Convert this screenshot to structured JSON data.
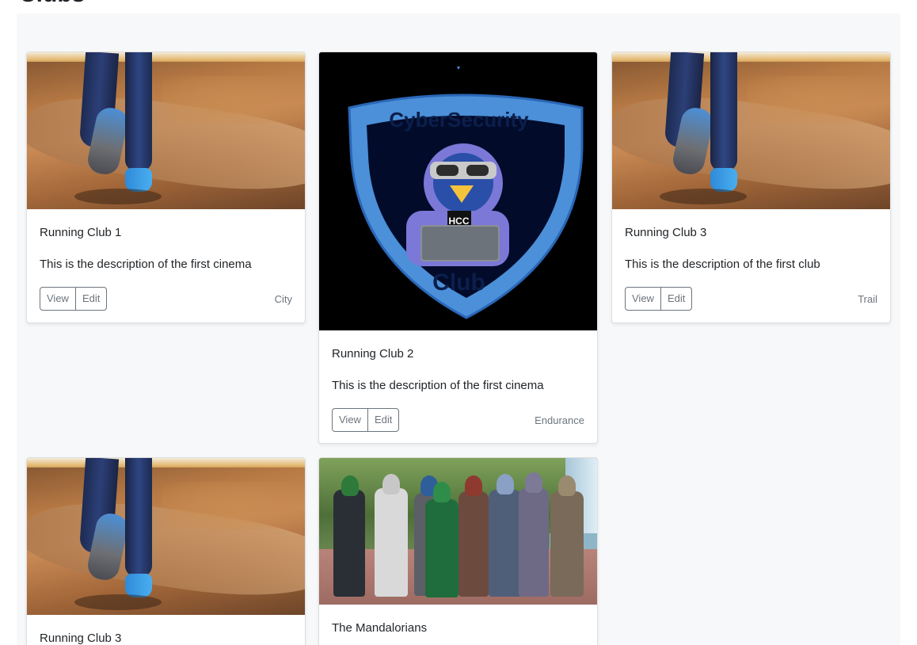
{
  "page": {
    "heading": "Clubs"
  },
  "cards": [
    {
      "title": "Running Club 1",
      "description": "This is the description of the first cinema",
      "category": "City",
      "view_label": "View",
      "edit_label": "Edit",
      "image": "running-shoes-photo"
    },
    {
      "title": "Running Club 2",
      "description": "This is the description of the first cinema",
      "category": "Endurance",
      "view_label": "View",
      "edit_label": "Edit",
      "image": "cybersecurity-club-logo"
    },
    {
      "title": "Running Club 3",
      "description": "This is the description of the first club",
      "category": "Trail",
      "view_label": "View",
      "edit_label": "Edit",
      "image": "running-shoes-photo"
    },
    {
      "title": "Running Club 3",
      "image": "running-shoes-photo"
    },
    {
      "title": "The Mandalorians",
      "image": "mandalorian-cosplay-photo"
    }
  ],
  "logo": {
    "top_text": "CyberSecurity",
    "badge_text": "HCC",
    "bottom_text": "Club"
  },
  "colors": {
    "button_border": "#6c757d",
    "album_background": "#f7f8fa",
    "logo_shield_blue": "#4c8fd6"
  }
}
